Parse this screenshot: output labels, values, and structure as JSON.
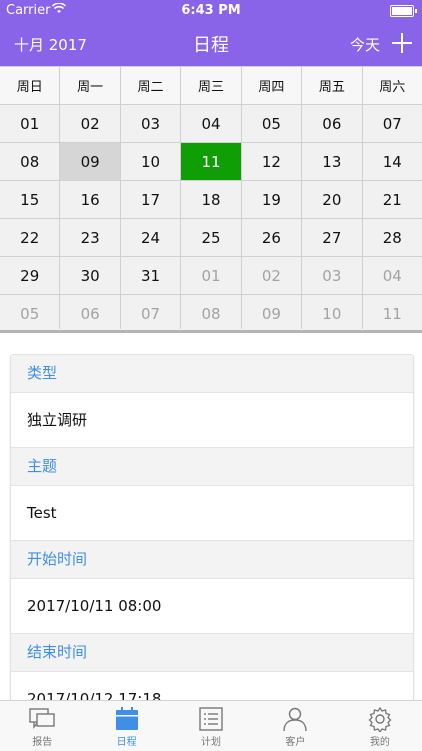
{
  "status_bar": {
    "carrier": "Carrier",
    "time": "6:43 PM"
  },
  "nav": {
    "month": "十月 2017",
    "title": "日程",
    "today": "今天"
  },
  "calendar": {
    "weekdays": [
      "周日",
      "周一",
      "周二",
      "周三",
      "周四",
      "周五",
      "周六"
    ],
    "days": [
      "01",
      "02",
      "03",
      "04",
      "05",
      "06",
      "07",
      "08",
      "09",
      "10",
      "11",
      "12",
      "13",
      "14",
      "15",
      "16",
      "17",
      "18",
      "19",
      "20",
      "21",
      "22",
      "23",
      "24",
      "25",
      "26",
      "27",
      "28",
      "29",
      "30",
      "31",
      "01",
      "02",
      "03",
      "04",
      "05",
      "06",
      "07",
      "08",
      "09",
      "10",
      "11"
    ],
    "selected_index": 8,
    "today_index": 10,
    "muted_from_index": 31
  },
  "details": [
    {
      "label": "类型",
      "value": "独立调研"
    },
    {
      "label": "主题",
      "value": "Test"
    },
    {
      "label": "开始时间",
      "value": "2017/10/11 08:00"
    },
    {
      "label": "结束时间",
      "value": "2017/10/12 17:18"
    }
  ],
  "tabs": [
    {
      "label": "报告",
      "icon": "report-icon",
      "active": false
    },
    {
      "label": "日程",
      "icon": "calendar-icon",
      "active": true
    },
    {
      "label": "计划",
      "icon": "plan-icon",
      "active": false
    },
    {
      "label": "客户",
      "icon": "customer-icon",
      "active": false
    },
    {
      "label": "我的",
      "icon": "settings-icon",
      "active": false
    }
  ],
  "colors": {
    "accent": "#8a64e8",
    "today": "#0f9e06",
    "label_blue": "#3f8fe6"
  }
}
